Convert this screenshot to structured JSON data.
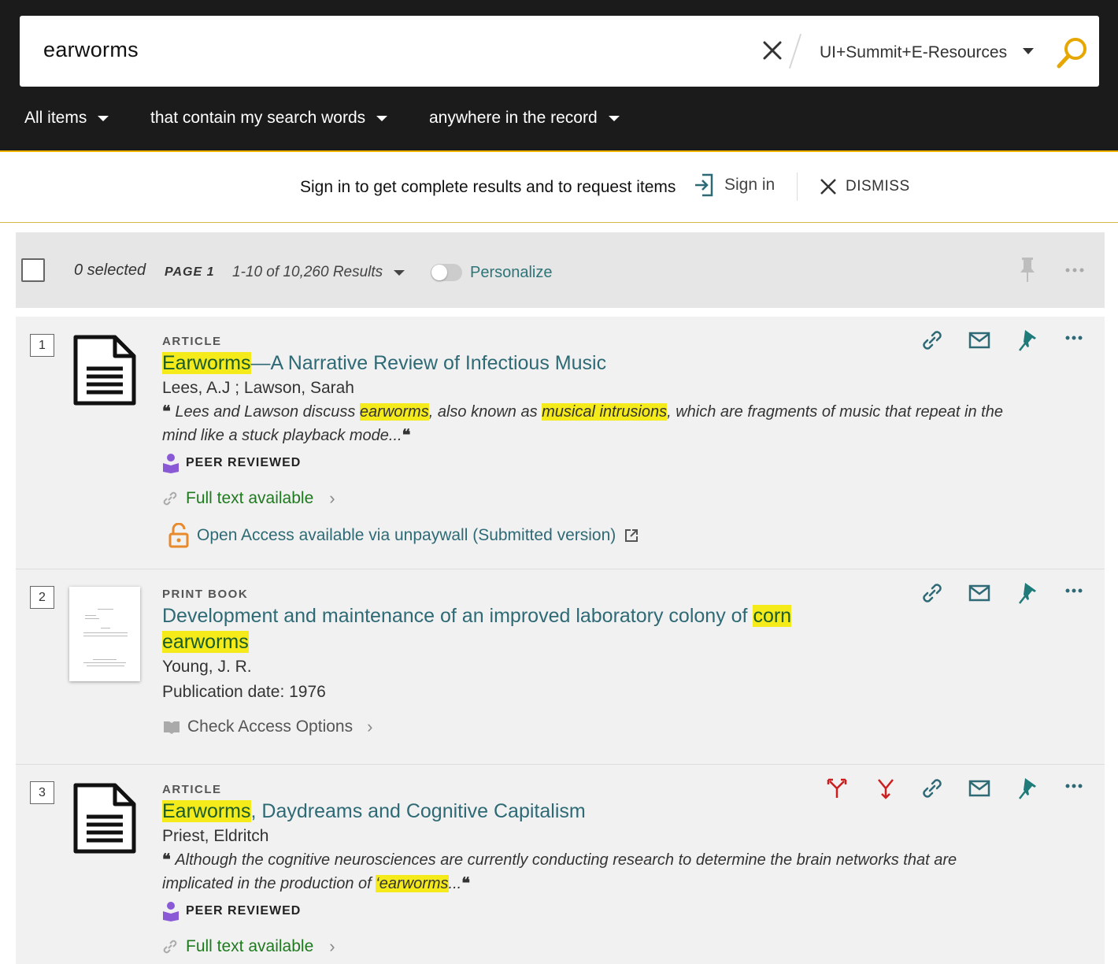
{
  "search": {
    "query": "earworms",
    "scope": "UI+Summit+E-Resources"
  },
  "filters": {
    "items": "All items",
    "match": "that contain my search words",
    "field": "anywhere in the record"
  },
  "signin_bar": {
    "message": "Sign in to get complete results and to request items",
    "signin_label": "Sign in",
    "dismiss_label": "DISMISS"
  },
  "toolbar": {
    "selected": "0 selected",
    "page": "PAGE 1",
    "results": "1-10 of 10,260 Results",
    "personalize": "Personalize"
  },
  "results": [
    {
      "number": "1",
      "type": "ARTICLE",
      "title_hl": "Earworms",
      "title_rest": "—A Narrative Review of Infectious Music",
      "authors": "Lees, A.J ; Lawson, Sarah",
      "snippet_1": "Lees and Lawson discuss ",
      "snippet_hl1": "earworms",
      "snippet_2": ", also known as ",
      "snippet_hl2": "musical intrusions",
      "snippet_3": ", which are fragments of music that repeat in the mind like a stuck playback mode...",
      "peer_reviewed": "PEER REVIEWED",
      "fulltext": "Full text available",
      "oa_link": "Open Access",
      "oa_rest": " available via unpaywall  (Submitted version)"
    },
    {
      "number": "2",
      "type": "PRINT BOOK",
      "title_1": "Development and maintenance of an improved laboratory colony of ",
      "title_hl1": "corn",
      "title_hl2": "earworms",
      "authors": "Young, J. R.",
      "pubdate": "Publication date: 1976",
      "check_access": "Check Access Options"
    },
    {
      "number": "3",
      "type": "ARTICLE",
      "title_hl": "Earworms",
      "title_rest": ", Daydreams and Cognitive Capitalism",
      "authors": "Priest, Eldritch",
      "snippet_1": "Although the cognitive neurosciences are currently conducting research to determine the brain networks that are implicated in the production of ",
      "snippet_hl1": "‘earworms",
      "snippet_2": "...",
      "peer_reviewed": "PEER REVIEWED",
      "fulltext": "Full text available"
    }
  ],
  "colors": {
    "header_bg": "#1b1b1b",
    "accent_teal": "#2e6a75",
    "highlight": "#f5ea1a",
    "fulltext_green": "#1f7a1f",
    "oa_orange": "#e8892b",
    "peer_purple": "#8a5ad6",
    "citation_red": "#cc1e1e"
  },
  "icons": [
    "clear-icon",
    "caret-down-icon",
    "search-icon",
    "sign-in-icon",
    "close-icon",
    "pin-icon",
    "more-icon",
    "document-icon",
    "link-icon",
    "email-icon",
    "peer-reviewed-icon",
    "chain-link-icon",
    "chevron-right-icon",
    "open-lock-icon",
    "external-link-icon",
    "book-icon",
    "cited-by-icon",
    "citing-icon"
  ]
}
